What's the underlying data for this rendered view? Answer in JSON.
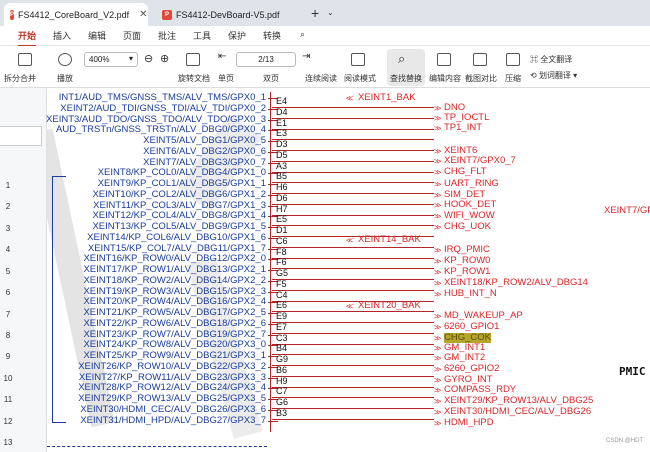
{
  "tabs": [
    {
      "label": "FS4412_CoreBoard_V2.pdf",
      "active": true
    },
    {
      "label": "FS4412-DevBoard-V5.pdf",
      "active": false
    }
  ],
  "menu": [
    "开始",
    "插入",
    "编辑",
    "页面",
    "批注",
    "工具",
    "保护",
    "转换"
  ],
  "toolbar": {
    "split": "拆分合并",
    "play": "播放",
    "zoom": "400%",
    "page": "2/13",
    "rotate": "旋转文档",
    "single": "单页",
    "double": "双页",
    "continuous": "连续阅读",
    "read": "阅读模式",
    "find": "查找替换",
    "edit": "编辑内容",
    "compare": "截图对比",
    "compress": "压缩",
    "fulltrans": "全文翻译",
    "wordtrans": "划词翻译"
  },
  "line_numbers": [
    "1",
    "2",
    "3",
    "4",
    "5",
    "6",
    "7",
    "8",
    "9",
    "10",
    "11",
    "12",
    "13"
  ],
  "left_labels": [
    "INT1/AUD_TMS/GNSS_TMS/ALV_TMS/GPX0_1",
    "XEINT2/AUD_TDI/GNSS_TDI/ALV_TDI/GPX0_2",
    "XEINT3/AUD_TDO/GNSS_TDO/ALV_TDO/GPX0_3",
    "AUD_TRSTn/GNSS_TRSTn/ALV_DBG0/GPX0_4",
    "XEINT5/ALV_DBG1/GPX0_5",
    "XEINT6/ALV_DBG2/GPX0_6",
    "XEINT7/ALV_DBG3/GPX0_7",
    "XEINT8/KP_COL0/ALV_DBG4/GPX1_0",
    "XEINT9/KP_COL1/ALV_DBG5/GPX1_1",
    "XEINT10/KP_COL2/ALV_DBG6/GPX1_2",
    "XEINT11/KP_COL3/ALV_DBG7/GPX1_3",
    "XEINT12/KP_COL4/ALV_DBG8/GPX1_4",
    "XEINT13/KP_COL5/ALV_DBG9/GPX1_5",
    "XEINT14/KP_COL6/ALV_DBG10/GPX1_6",
    "XEINT15/KP_COL7/ALV_DBG11/GPX1_7",
    "XEINT16/KP_ROW0/ALV_DBG12/GPX2_0",
    "XEINT17/KP_ROW1/ALV_DBG13/GPX2_1",
    "XEINT18/KP_ROW2/ALV_DBG14/GPX2_2",
    "XEINT19/KP_ROW3/ALV_DBG15/GPX2_3",
    "XEINT20/KP_ROW4/ALV_DBG16/GPX2_4",
    "XEINT21/KP_ROW5/ALV_DBG17/GPX2_5",
    "XEINT22/KP_ROW6/ALV_DBG18/GPX2_6",
    "XEINT23/KP_ROW7/ALV_DBG19/GPX2_7",
    "XEINT24/KP_ROW8/ALV_DBG20/GPX3_0",
    "XEINT25/KP_ROW9/ALV_DBG21/GPX3_1",
    "XEINT26/KP_ROW10/ALV_DBG22/GPX3_2",
    "XEINT27/KP_ROW11/ALV_DBG23/GPX3_3",
    "XEINT28/KP_ROW12/ALV_DBG24/GPX3_4",
    "XEINT29/KP_ROW13/ALV_DBG25/GPX3_5",
    "XEINT30/HDMI_CEC/ALV_DBG26/GPX3_6",
    "XEINT31/HDMI_HPD/ALV_DBG27/GPX3_7"
  ],
  "pins": [
    "E4",
    "D4",
    "E1",
    "E3",
    "D3",
    "D5",
    "A3",
    "B5",
    "H6",
    "D6",
    "H7",
    "E5",
    "D1",
    "C6",
    "F8",
    "F6",
    "G5",
    "F5",
    "C4",
    "E6",
    "E9",
    "E7",
    "C3",
    "B4",
    "G9",
    "B6",
    "H9",
    "C7",
    "G6",
    "B3"
  ],
  "nets": {
    "n_e5": "XEINT1_BAK",
    "n_d4": "DNO",
    "n_e1": "TP_IOCTL",
    "n_e3": "TP1_INT",
    "n_d5a": "XEINT6",
    "n_d5b": "XEINT7/GPX0_7",
    "n_a3": "CHG_FLT",
    "n_h6": "UART_RING",
    "n_d6": "SIM_DET",
    "n_h7a": "HOOK_DET",
    "n_h7b": "WIFI_WOW",
    "n_e5b": "CHG_UOK",
    "n_c6": "XEINT14_BAK",
    "n_f8": "IRQ_PMIC",
    "n_f6": "KP_ROW0",
    "n_g5": "KP_ROW1",
    "n_f5a": "XEINT18/KP_ROW2/ALV_DBG14",
    "n_f5b": "HUB_INT_N",
    "n_e6": "XEINT20_BAK",
    "n_e9": "MD_WAKEUP_AP",
    "n_e7": "6260_GPIO1",
    "n_c3": "CHG_COK",
    "n_b4": "GM_INT1",
    "n_g9": "GM_INT2",
    "n_b6": "6260_GPIO2",
    "n_h9": "GYRO_INT",
    "n_c7": "COMPASS_RDY",
    "n_g6": "XEINT29/KP_ROW13/ALV_DBG25",
    "n_b3a": "XEINT30/HDMI_CEC/ALV_DBG26",
    "n_b3b": "HDMI_HPD",
    "far": "XEINT7/GP",
    "pmic": "PMIC",
    "wm": "CSDN @HDT"
  }
}
